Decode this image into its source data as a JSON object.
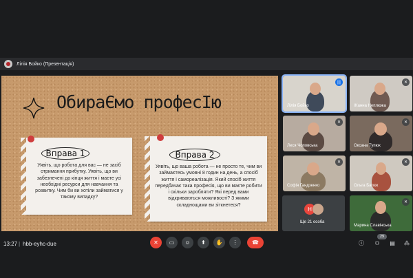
{
  "presenting": {
    "label": "Лілія Бойко (Презентація)"
  },
  "slide": {
    "title": "ОбираЄмо професІю",
    "exercise1": {
      "label": "Вправа 1",
      "text": "Уявіть, що робота для вас — не засіб отримання прибутку. Уявіть, що ви забезпечені до кінця життя і маєте усі необхідні ресурси для навчання та розвитку. Чим би ви хотіли займатися у такому випадку?"
    },
    "exercise2": {
      "label": "Вправа 2",
      "text": "Уявіть, що ваша робота — не просто те, чим ви займаєтесь умовні 8 годин на день, а спосіб життя і самореалізація. Який спосіб життя передбачає така професія, що ви маєте робити і скільки заробляти? Які перед вами відкриваються можливості? З якими складнощами ви зіткнетеся?"
    }
  },
  "participants": [
    {
      "name": "Лілія Бойко",
      "muted": false
    },
    {
      "name": "Жанна Неплюжа",
      "muted": true
    },
    {
      "name": "Леся Чоповська",
      "muted": true
    },
    {
      "name": "Оксана Тупюк",
      "muted": true
    },
    {
      "name": "Софія Гандзенко",
      "muted": true
    },
    {
      "name": "Ольга Батюк",
      "muted": true
    },
    {
      "name": "Марина Славінська",
      "muted": true
    }
  ],
  "more": {
    "label": "Ще 21 особа",
    "initial": "Н"
  },
  "bottom": {
    "time": "13:27",
    "separator": "|",
    "meeting_code": "hbb-eyhc-due",
    "people_count": "29"
  },
  "colors": {
    "accent": "#8ab4f8",
    "end_call": "#ea4335",
    "cork": "#c79a6c"
  },
  "icons": [
    "mic-off-icon",
    "camera-icon",
    "emoji-icon",
    "present-icon",
    "raise-hand-icon",
    "more-icon",
    "end-call-icon",
    "info-icon",
    "people-icon",
    "chat-icon",
    "activities-icon"
  ]
}
